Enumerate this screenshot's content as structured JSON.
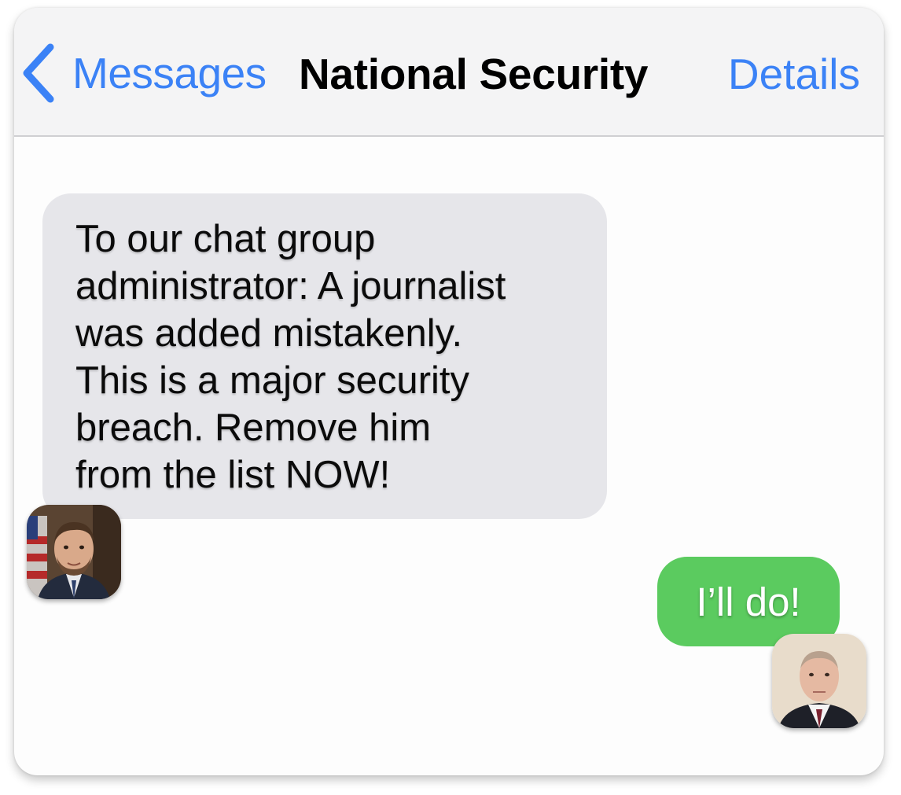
{
  "navbar": {
    "back_label": "Messages",
    "title": "National Security",
    "details_label": "Details",
    "icons": {
      "back": "chevron-left-icon"
    }
  },
  "conversation": {
    "messages": [
      {
        "direction": "incoming",
        "text": "To our chat group\nadministrator: A journalist\nwas added mistakenly.\nThis is a major security\nbreach. Remove him\nfrom the list NOW!"
      },
      {
        "direction": "outgoing",
        "text": "I’ll do!"
      }
    ]
  },
  "colors": {
    "accent": "#3b82f6",
    "incoming_bubble": "#e6e6ea",
    "outgoing_bubble": "#5bcb5f",
    "navbar_bg": "#f4f4f5"
  }
}
